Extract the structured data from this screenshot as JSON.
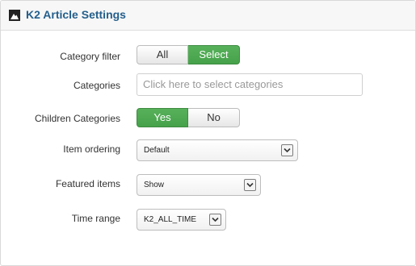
{
  "panel": {
    "title": "K2 Article Settings",
    "icon": "k2-logo-icon"
  },
  "category_filter": {
    "label": "Category filter",
    "options": [
      "All",
      "Select"
    ],
    "selected": "Select"
  },
  "categories": {
    "label": "Categories",
    "placeholder": "Click here to select categories"
  },
  "children_categories": {
    "label": "Children Categories",
    "options": [
      "Yes",
      "No"
    ],
    "selected": "Yes"
  },
  "item_ordering": {
    "label": "Item ordering",
    "value": "Default"
  },
  "featured_items": {
    "label": "Featured items",
    "value": "Show"
  },
  "time_range": {
    "label": "Time range",
    "value": "K2_ALL_TIME"
  },
  "colors": {
    "active_green": "#4aa54e",
    "title_blue": "#245f8c"
  }
}
